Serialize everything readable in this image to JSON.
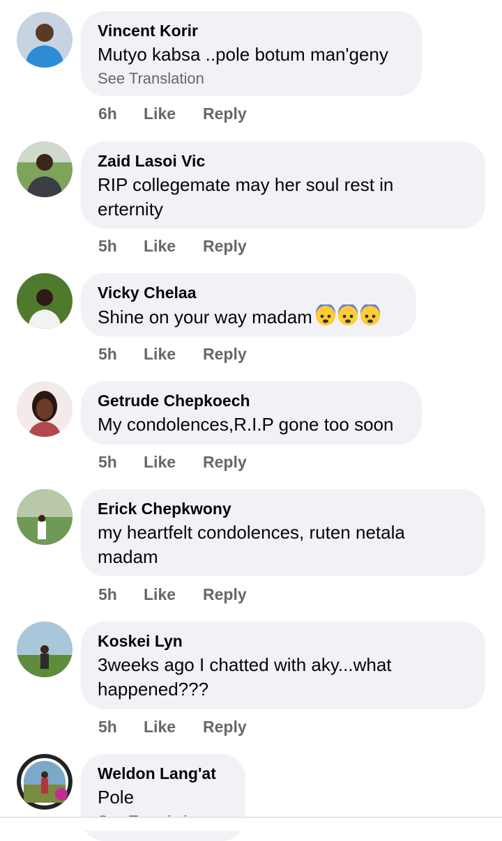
{
  "actions": {
    "like": "Like",
    "reply": "Reply"
  },
  "comments": [
    {
      "author": "Vincent Korir",
      "text": "Mutyo kabsa ..pole botum man'geny",
      "translation_link": "See Translation",
      "time": "6h"
    },
    {
      "author": "Zaid Lasoi Vic",
      "text": "RIP collegemate may her soul rest in erternity",
      "time": "5h"
    },
    {
      "author": "Vicky Chelaa",
      "text": "Shine on your way madam",
      "emoji": "fearful-face x3",
      "time": "5h"
    },
    {
      "author": "Getrude Chepkoech",
      "text": "My condolences,R.I.P gone too soon",
      "time": "5h"
    },
    {
      "author": "Erick Chepkwony",
      "text": "my heartfelt condolences, ruten netala madam",
      "time": "5h"
    },
    {
      "author": "Koskei Lyn",
      "text": "3weeks ago I chatted with aky...what happened???",
      "time": "5h"
    },
    {
      "author": "Weldon Lang'at",
      "text": "Pole",
      "translation_link": "See Translation"
    }
  ]
}
